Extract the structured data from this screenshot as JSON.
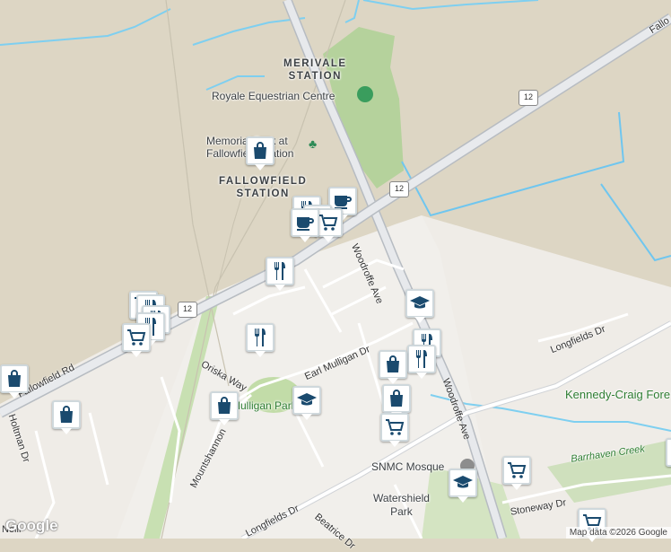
{
  "labels": {
    "merivale_station": "MERIVALE\nSTATION",
    "fallowfield_station": "FALLOWFIELD\nSTATION",
    "royale_equestrian": "Royale Equestrian Centre",
    "memorial_park": "Memorial Park at\nFallowfield Station",
    "kennedy_craig": "Kennedy-Craig Fore",
    "barrhaven_creek": "Barrhaven Creek",
    "snmc_mosque": "SNMC Mosque",
    "watershield_park": "Watershield\nPark",
    "mulligan_park": "Mulligan Park"
  },
  "roads": {
    "woodroffe_ave_1": "Woodroffe Ave",
    "woodroffe_ave_2": "Woodroffe Ave",
    "fallowfield_rd": "Fallowfield Rd",
    "fallowfield_ne": "Fallo",
    "longfields_dr_1": "Longfields Dr",
    "longfields_dr_2": "Longfields Dr",
    "earl_mulligan_dr": "Earl Mulligan Dr",
    "oriska_way": "Oriska Way",
    "mountshannon": "Mountshannon",
    "holtman_dr": "Holtman Dr",
    "beatrice_dr": "Beatrice Dr",
    "stoneway_dr": "Stoneway Dr",
    "neill": "Neill",
    "hwy12_a": "12",
    "hwy12_b": "12",
    "hwy12_c": "12"
  },
  "markers": [
    {
      "name": "shopping-bag-icon",
      "type": "bag"
    },
    {
      "name": "coffee-icon",
      "type": "coffee"
    },
    {
      "name": "restaurant-icon",
      "type": "fork"
    },
    {
      "name": "restaurant-icon",
      "type": "fork"
    },
    {
      "name": "restaurant-icon",
      "type": "fork"
    },
    {
      "name": "shopping-cart-icon",
      "type": "cart"
    },
    {
      "name": "school-icon",
      "type": "school"
    },
    {
      "name": "shopping-bag-icon",
      "type": "bag"
    }
  ],
  "attribution": "Map data ©2026 Google",
  "logo": "Google"
}
